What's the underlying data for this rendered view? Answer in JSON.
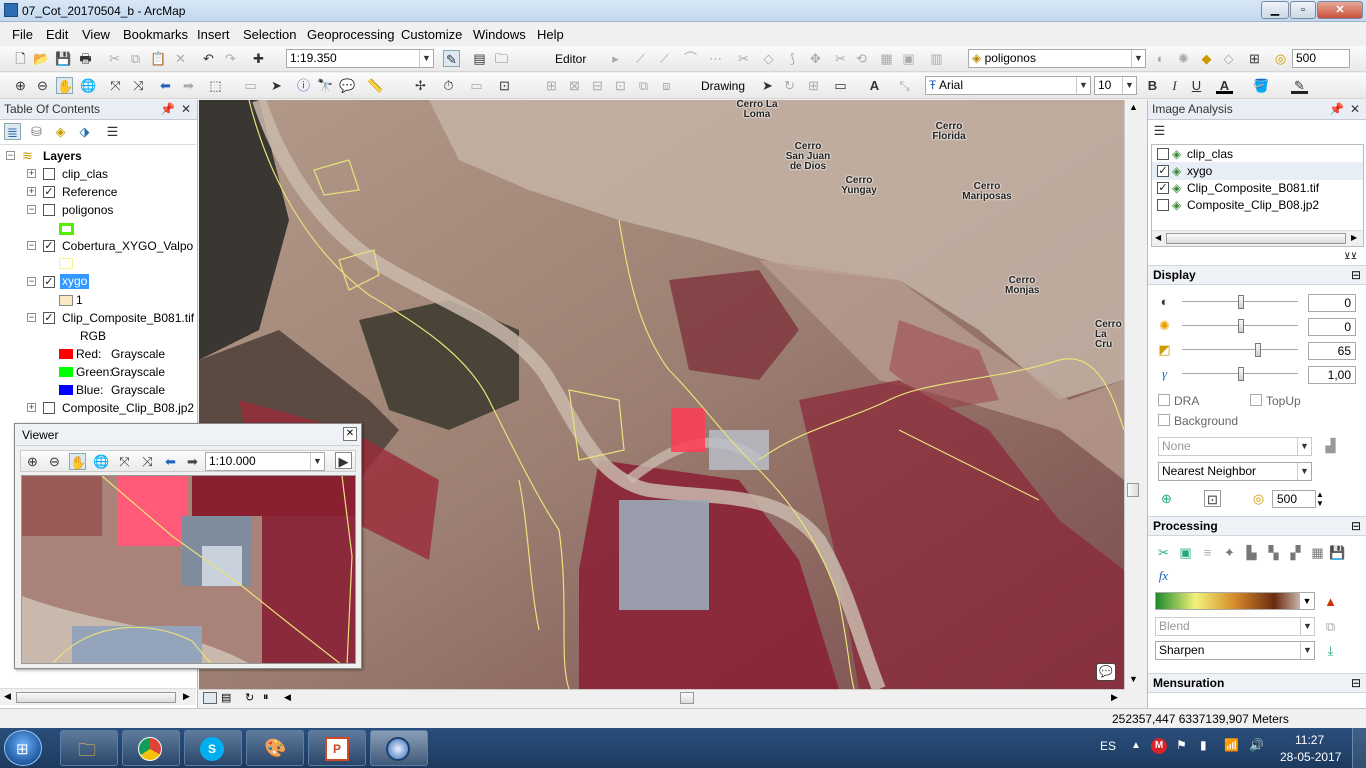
{
  "window": {
    "title": "07_Cot_20170504_b - ArcMap",
    "min": "▁",
    "max": "▫",
    "close": "✕"
  },
  "menu": [
    "File",
    "Edit",
    "View",
    "Bookmarks",
    "Insert",
    "Selection",
    "Geoprocessing",
    "Customize",
    "Windows",
    "Help"
  ],
  "toolbar": {
    "scale": "1:19.350",
    "editor": "Editor",
    "drawing": "Drawing",
    "target_layer": "poligonos",
    "font": "Arial",
    "font_size": "10",
    "bold": "B",
    "italic": "I",
    "underline": "U",
    "cache_size": "500"
  },
  "toc": {
    "title": "Table Of Contents",
    "root": "Layers",
    "layers": [
      {
        "name": "clip_clas",
        "checked": false
      },
      {
        "name": "Reference",
        "checked": true
      },
      {
        "name": "poligonos",
        "checked": false
      },
      {
        "name": "Cobertura_XYGO_Valpo",
        "checked": true
      },
      {
        "name": "xygo",
        "checked": true
      },
      {
        "name": "Clip_Composite_B081.tif",
        "checked": true
      },
      {
        "name": "Composite_Clip_B08.jp2",
        "checked": false
      }
    ],
    "xygo_value": "1",
    "rgb_label": "RGB",
    "bands": [
      {
        "label": "Red:",
        "value": "Grayscale",
        "color": "#ff0000"
      },
      {
        "label": "Green:",
        "value": "Grayscale",
        "color": "#00ff00"
      },
      {
        "label": "Blue:",
        "value": "Grayscale",
        "color": "#0000ff"
      }
    ]
  },
  "viewer": {
    "title": "Viewer",
    "scale": "1:10.000"
  },
  "map_labels": [
    {
      "text": "Cerro La Loma"
    },
    {
      "text": "Cerro San Juan de Dios"
    },
    {
      "text": "Cerro Yungay"
    },
    {
      "text": "Cerro Florida"
    },
    {
      "text": "Cerro Mariposas"
    },
    {
      "text": "Cerro Monjas"
    },
    {
      "text": "Cerro La Cru"
    }
  ],
  "image_analysis": {
    "title": "Image Analysis",
    "layers": [
      {
        "name": "clip_clas",
        "checked": false
      },
      {
        "name": "xygo",
        "checked": true
      },
      {
        "name": "Clip_Composite_B081.tif",
        "checked": true
      },
      {
        "name": "Composite_Clip_B08.jp2",
        "checked": false
      }
    ],
    "display": {
      "title": "Display",
      "contrast": "0",
      "brightness": "0",
      "transparency": "65",
      "gamma": "1,00",
      "dra": "DRA",
      "topup": "TopUp",
      "background": "Background",
      "stretch": "None",
      "resampling": "Nearest Neighbor",
      "cache": "500"
    },
    "processing": {
      "title": "Processing",
      "blend": "Blend",
      "sharpen": "Sharpen"
    },
    "mensuration": {
      "title": "Mensuration"
    }
  },
  "status": {
    "coords": "252357,447  6337139,907 Meters"
  },
  "taskbar": {
    "lang": "ES",
    "time": "11:27",
    "date": "28-05-2017"
  },
  "colors": {
    "accent": "#1e73be",
    "taskbar": "#1d3a5e",
    "outline": "#e8e27a"
  }
}
